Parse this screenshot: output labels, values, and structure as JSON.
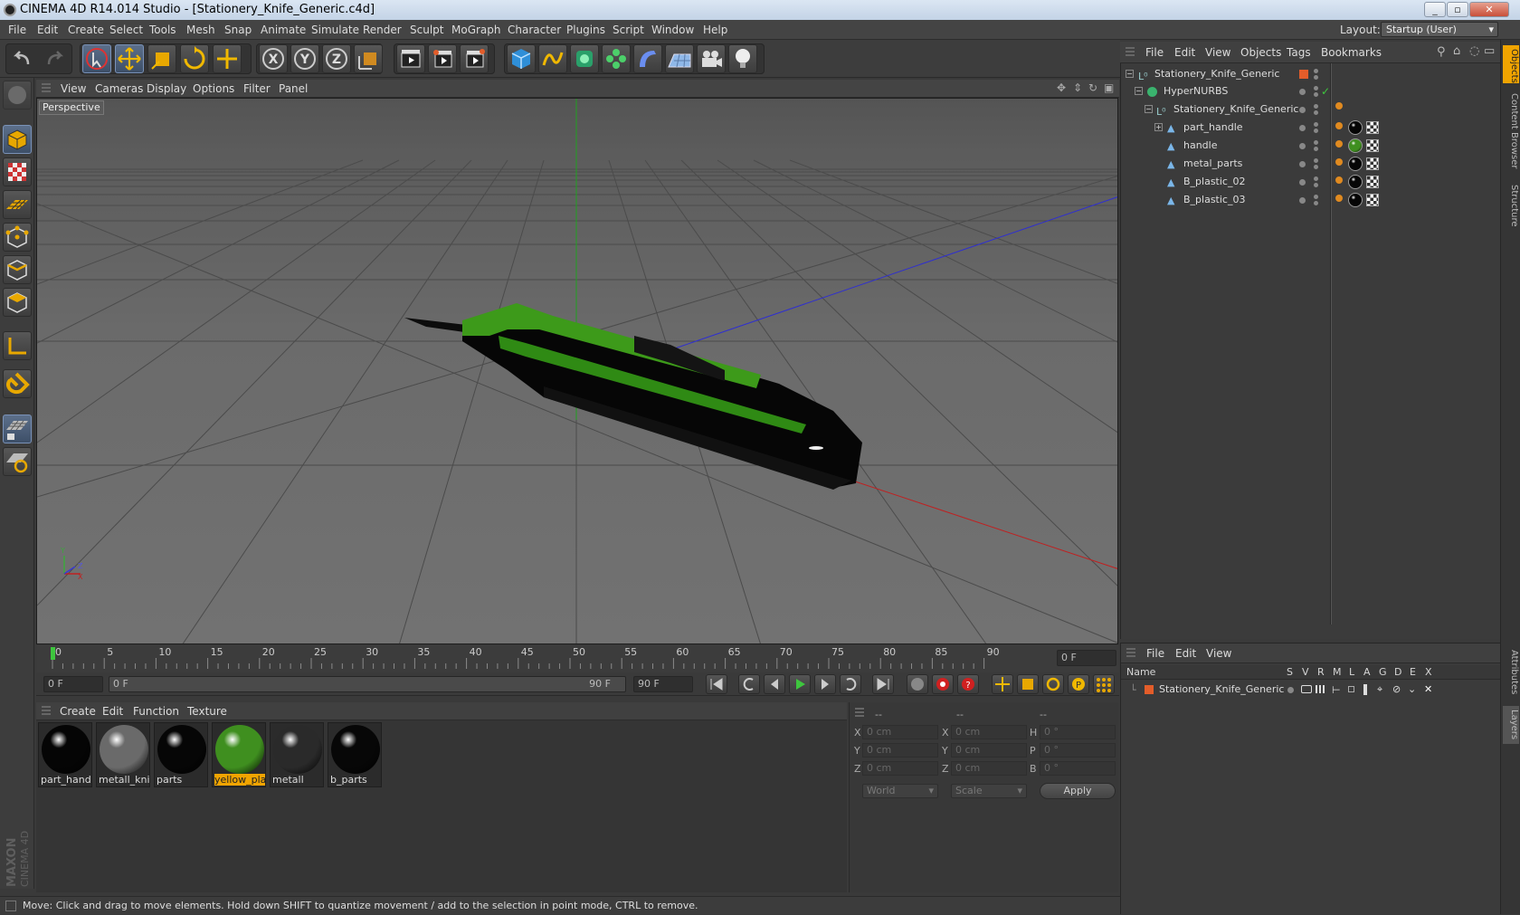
{
  "window": {
    "title": "CINEMA 4D R14.014 Studio - [Stationery_Knife_Generic.c4d]"
  },
  "menubar": [
    "File",
    "Edit",
    "Create",
    "Select",
    "Tools",
    "Mesh",
    "Snap",
    "Animate",
    "Simulate",
    "Render",
    "Sculpt",
    "MoGraph",
    "Character",
    "Plugins",
    "Script",
    "Window",
    "Help"
  ],
  "layout": {
    "label": "Layout:",
    "value": "Startup (User)"
  },
  "viewport": {
    "menu": [
      "View",
      "Cameras",
      "Display",
      "Options",
      "Filter",
      "Panel"
    ],
    "label": "Perspective",
    "axis_labels": {
      "y": "Y",
      "z": "Z",
      "x": "X"
    }
  },
  "timeline": {
    "ticks": [
      "0",
      "5",
      "10",
      "15",
      "20",
      "25",
      "30",
      "35",
      "40",
      "45",
      "50",
      "55",
      "60",
      "65",
      "70",
      "75",
      "80",
      "85",
      "90"
    ],
    "current_frame": "0 F",
    "start": "0 F",
    "range_start": "0 F",
    "range_end": "90 F",
    "end": "90 F"
  },
  "materials": {
    "menu": [
      "Create",
      "Edit",
      "Function",
      "Texture"
    ],
    "items": [
      {
        "name": "part_handl",
        "color": "#050505",
        "selected": false
      },
      {
        "name": "metall_knif",
        "color": "#6a6a6a",
        "selected": false
      },
      {
        "name": "parts",
        "color": "#060606",
        "selected": false
      },
      {
        "name": "yellow_pla:",
        "color": "#3f8f1f",
        "selected": true
      },
      {
        "name": "metall",
        "color": "#2a2a2a",
        "selected": false
      },
      {
        "name": "b_parts",
        "color": "#070707",
        "selected": false
      }
    ]
  },
  "coords": {
    "headers": [
      "--",
      "--",
      "--"
    ],
    "rows": [
      {
        "a": "X",
        "av": "0 cm",
        "b": "X",
        "bv": "0 cm",
        "c": "H",
        "cv": "0 °"
      },
      {
        "a": "Y",
        "av": "0 cm",
        "b": "Y",
        "bv": "0 cm",
        "c": "P",
        "cv": "0 °"
      },
      {
        "a": "Z",
        "av": "0 cm",
        "b": "Z",
        "bv": "0 cm",
        "c": "B",
        "cv": "0 °"
      }
    ],
    "world": "World",
    "scale": "Scale",
    "apply": "Apply"
  },
  "objects": {
    "menu": [
      "File",
      "Edit",
      "View",
      "Objects",
      "Tags",
      "Bookmarks"
    ],
    "tree": [
      {
        "name": "Stationery_Knife_Generic",
        "indent": 0
      },
      {
        "name": "HyperNURBS",
        "indent": 1
      },
      {
        "name": "Stationery_Knife_Generic",
        "indent": 2
      },
      {
        "name": "part_handle",
        "indent": 3
      },
      {
        "name": "handle",
        "indent": 3
      },
      {
        "name": "metal_parts",
        "indent": 3
      },
      {
        "name": "B_plastic_02",
        "indent": 3
      },
      {
        "name": "B_plastic_03",
        "indent": 3
      }
    ]
  },
  "layers": {
    "menu": [
      "File",
      "Edit",
      "View"
    ],
    "columns": [
      "Name",
      "S",
      "V",
      "R",
      "M",
      "L",
      "A",
      "G",
      "D",
      "E",
      "X"
    ],
    "rows": [
      {
        "name": "Stationery_Knife_Generic"
      }
    ]
  },
  "right_tabs": [
    "Objects",
    "Content Browser",
    "Structure",
    "Attributes",
    "Layers"
  ],
  "status": "Move: Click and drag to move elements. Hold down SHIFT to quantize movement / add to the selection in point mode, CTRL to remove.",
  "brand": {
    "maxon": "MAXON",
    "product": "CINEMA 4D"
  }
}
